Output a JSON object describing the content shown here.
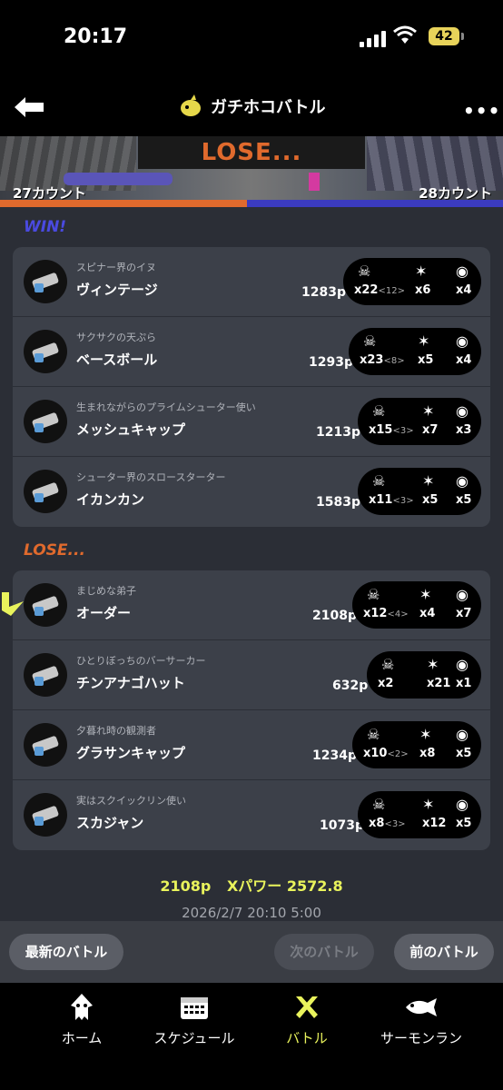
{
  "status_bar": {
    "time": "20:17",
    "battery": "42"
  },
  "header": {
    "title": "ガチホコバトル",
    "more": "•••"
  },
  "banner": {
    "result": "LOSE...",
    "left_count": "27カウント",
    "right_count": "28カウント"
  },
  "sections": {
    "win": "WIN!",
    "lose": "LOSE..."
  },
  "win_players": [
    {
      "tag": "スピナー界のイヌ",
      "name": "ヴィンテージ",
      "power": "1283p",
      "kills": "x22",
      "assists": "<12>",
      "specials": "x6",
      "count": "x4"
    },
    {
      "tag": "サクサクの天ぷら",
      "name": "ベースボール",
      "power": "1293p",
      "kills": "x23",
      "assists": "<8>",
      "specials": "x5",
      "count": "x4"
    },
    {
      "tag": "生まれながらのプライムシューター使い",
      "name": "メッシュキャップ",
      "power": "1213p",
      "kills": "x15",
      "assists": "<3>",
      "specials": "x7",
      "count": "x3"
    },
    {
      "tag": "シューター界のスロースターター",
      "name": "イカンカン",
      "power": "1583p",
      "kills": "x11",
      "assists": "<3>",
      "specials": "x5",
      "count": "x5"
    }
  ],
  "lose_players": [
    {
      "tag": "まじめな弟子",
      "name": "オーダー",
      "power": "2108p",
      "kills": "x12",
      "assists": "<4>",
      "specials": "x4",
      "count": "x7"
    },
    {
      "tag": "ひとりぼっちのバーサーカー",
      "name": "チンアナゴハット",
      "power": "632p",
      "kills": "x2",
      "assists": "",
      "specials": "x21",
      "count": "x1"
    },
    {
      "tag": "夕暮れ時の観測者",
      "name": "グラサンキャップ",
      "power": "1234p",
      "kills": "x10",
      "assists": "<2>",
      "specials": "x8",
      "count": "x5"
    },
    {
      "tag": "実はスクイックリン使い",
      "name": "スカジャン",
      "power": "1073p",
      "kills": "x8",
      "assists": "<3>",
      "specials": "x12",
      "count": "x5"
    }
  ],
  "summary": {
    "power": "2108p",
    "xpower": "Xパワー 2572.8",
    "datetime": "2026/2/7 20:10 5:00"
  },
  "buttons": {
    "latest": "最新のバトル",
    "next": "次のバトル",
    "prev": "前のバトル"
  },
  "tabs": [
    {
      "label": "ホーム",
      "icon": "squid-icon"
    },
    {
      "label": "スケジュール",
      "icon": "calendar-icon"
    },
    {
      "label": "バトル",
      "icon": "battle-icon"
    },
    {
      "label": "サーモンラン",
      "icon": "salmon-icon"
    }
  ],
  "colors": {
    "win": "#3b3bbf",
    "lose": "#e06a2d",
    "active_tab": "#e9f35c",
    "summary": "#e9f35c"
  }
}
